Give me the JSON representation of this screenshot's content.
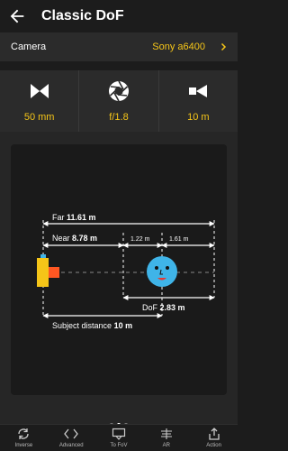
{
  "appbar": {
    "title": "Classic DoF"
  },
  "camera": {
    "label": "Camera",
    "value": "Sony a6400"
  },
  "params": [
    {
      "icon": "focal-length-icon",
      "value": "50 mm"
    },
    {
      "icon": "aperture-icon",
      "value": "f/1.8"
    },
    {
      "icon": "subject-distance-icon",
      "value": "10 m"
    }
  ],
  "diagram": {
    "far_label": "Far",
    "far_value": "11.61 m",
    "near_label": "Near",
    "near_value": "8.78 m",
    "near_dof": "1.22 m",
    "far_dof": "1.61 m",
    "dof_label": "DoF",
    "dof_value": "2.83 m",
    "subject_label": "Subject distance",
    "subject_value": "10 m"
  },
  "pager": {
    "pages": 3,
    "active": 1
  },
  "bottom_nav": [
    {
      "icon": "inverse-icon",
      "label": "Inverse"
    },
    {
      "icon": "advanced-icon",
      "label": "Advanced"
    },
    {
      "icon": "to-fov-icon",
      "label": "To FoV"
    },
    {
      "icon": "ar-icon",
      "label": "AR"
    },
    {
      "icon": "action-icon",
      "label": "Action"
    }
  ],
  "colors": {
    "accent": "#f5c518",
    "background": "#1c1c1c",
    "panel": "#2b2b2b",
    "subject": "#3fb4e8",
    "camera_body": "#f5c518",
    "lens": "#ff5722"
  }
}
